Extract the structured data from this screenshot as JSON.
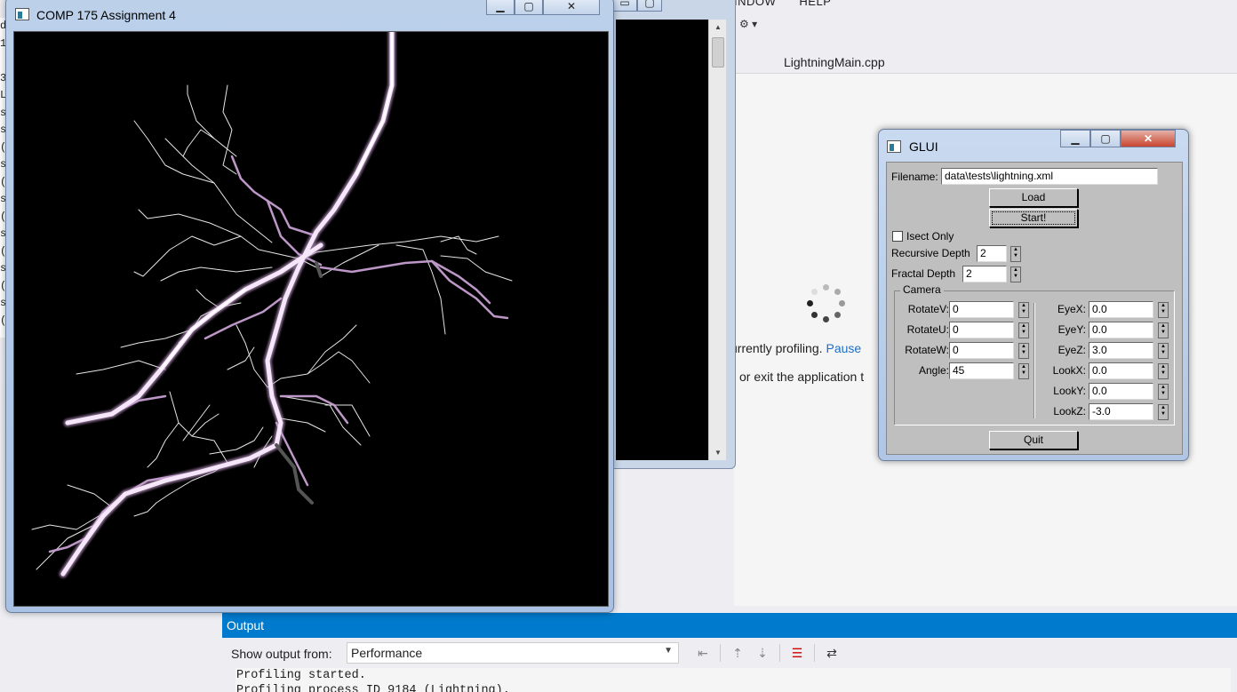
{
  "vs": {
    "menu": [
      "INDOW",
      "HELP"
    ],
    "tab": "LightningMain.cpp",
    "profiling_text": "urrently profiling.",
    "pause_link": "Pause",
    "exit_text": "or exit the application t"
  },
  "output": {
    "title": "Output",
    "show_from_label": "Show output from:",
    "source": "Performance",
    "lines": [
      "Profiling started.",
      "Profiling process ID 9184 (Lightning)."
    ]
  },
  "console": {
    "left_chars": [
      "d",
      "1",
      "",
      "3",
      "L",
      "s",
      "s",
      "(",
      "s",
      "(",
      "s",
      "(",
      "s",
      "(",
      "s",
      "(",
      "s",
      "("
    ]
  },
  "gl_window": {
    "title": "COMP 175 Assignment 4"
  },
  "glui": {
    "title": "GLUI",
    "filename_label": "Filename:",
    "filename_value": "data\\tests\\lightning.xml",
    "load_label": "Load",
    "start_label": "Start!",
    "isect_label": "Isect Only",
    "isect_checked": false,
    "recursive_depth_label": "Recursive Depth",
    "recursive_depth": "2",
    "fractal_depth_label": "Fractal Depth",
    "fractal_depth": "2",
    "camera_label": "Camera",
    "left_fields": [
      {
        "label": "RotateV:",
        "value": "0"
      },
      {
        "label": "RotateU:",
        "value": "0"
      },
      {
        "label": "RotateW:",
        "value": "0"
      },
      {
        "label": "Angle:",
        "value": "45"
      }
    ],
    "right_fields": [
      {
        "label": "EyeX:",
        "value": "0.0"
      },
      {
        "label": "EyeY:",
        "value": "0.0"
      },
      {
        "label": "EyeZ:",
        "value": "3.0"
      },
      {
        "label": "LookX:",
        "value": "0.0"
      },
      {
        "label": "LookY:",
        "value": "0.0"
      },
      {
        "label": "LookZ:",
        "value": "-3.0"
      }
    ],
    "quit_label": "Quit"
  },
  "colors": {
    "vs_blue": "#007acc",
    "bolt_core": "#f4e2f8",
    "bolt_glow": "#c8a0d2",
    "branch": "#ffffff"
  }
}
